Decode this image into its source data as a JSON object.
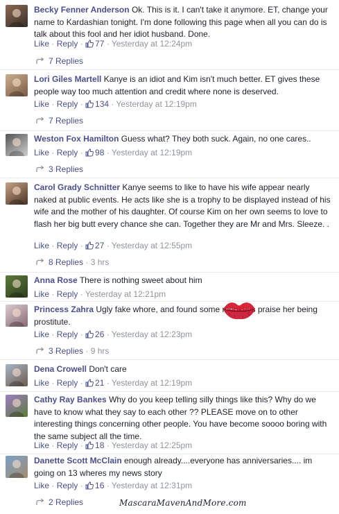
{
  "comments": [
    {
      "author": "Becky Fenner Anderson",
      "text": "Ok. This is it. I can't take it anymore. ET, change your name to Kardashian tonight. I'm done following this page when all you can do is talk about this fool and her idiot husband. Done.",
      "like": "Like",
      "reply": "Reply",
      "likes": "77",
      "time": "Yesterday at 12:24pm",
      "replies": "7 Replies",
      "replies_time": ""
    },
    {
      "author": "Lori Giles Martell",
      "text": "Kanye is an idiot and Kim isn't much better. ET gives these people way too much attention and credit where none is deserved.",
      "like": "Like",
      "reply": "Reply",
      "likes": "134",
      "time": "Yesterday at 12:19pm",
      "replies": "7 Replies",
      "replies_time": ""
    },
    {
      "author": "Weston Fox Hamilton",
      "text": "Guess what? They both suck. Again, no one cares..",
      "like": "Like",
      "reply": "Reply",
      "likes": "98",
      "time": "Yesterday at 12:19pm",
      "replies": "3 Replies",
      "replies_time": ""
    },
    {
      "author": "Carol Grady Schnitter",
      "text": "Kanye seems to like to have his wife appear nearly naked at public events. He acts like she is a trophy to be displayed instead of his wife and the mother of his daughter. Of course Kim on her own seems to love to flash her big butt every chance she can. Together they are Mr and Mrs. Sleeze. .",
      "like": "Like",
      "reply": "Reply",
      "likes": "27",
      "time": "Yesterday at 12:55pm",
      "replies": "8 Replies",
      "replies_time": "3 hrs"
    },
    {
      "author": "Anna Rose",
      "text": "There is nothing sweet about him",
      "like": "Like",
      "reply": "Reply",
      "likes": "",
      "time": "Yesterday at 12:21pm",
      "replies": "",
      "replies_time": ""
    },
    {
      "author": "Princess Zahra",
      "text": "Ugly fake whore, and found some monkeys praise her being prostitute.",
      "like": "Like",
      "reply": "Reply",
      "likes": "26",
      "time": "Yesterday at 12:23pm",
      "replies": "3 Replies",
      "replies_time": "9 hrs"
    },
    {
      "author": "Dena Crowell",
      "text": "Don't care",
      "like": "Like",
      "reply": "Reply",
      "likes": "21",
      "time": "Yesterday at 12:19pm",
      "replies": "",
      "replies_time": ""
    },
    {
      "author": "Cathy Ray Bankes",
      "text": "Why do you keep telling silly things like this? Why do we have to know what they say to each other ?? PLEASE move on to other interesting things concerning other people. You have become soooo boring with the same subject all the time.",
      "like": "Like",
      "reply": "Reply",
      "likes": "18",
      "time": "Yesterday at 12:25pm",
      "replies": "",
      "replies_time": ""
    },
    {
      "author": "Danette Scott McClain",
      "text": "enough already....everyone has anniversaries.... im going on 13 wheres my news story",
      "like": "Like",
      "reply": "Reply",
      "likes": "16",
      "time": "Yesterday at 12:31pm",
      "replies": "2 Replies",
      "replies_time": ""
    }
  ],
  "separator": " · ",
  "watermark": "MascaraMavenAndMore.com",
  "icons": {
    "like": "thumbs-up-icon",
    "reply_arrow": "reply-arrow-icon",
    "decor": "red-lips-icon"
  },
  "colors": {
    "link": "#4b4f8f",
    "meta": "#90949c",
    "text": "#1d2129",
    "divider": "#e9ebee"
  }
}
